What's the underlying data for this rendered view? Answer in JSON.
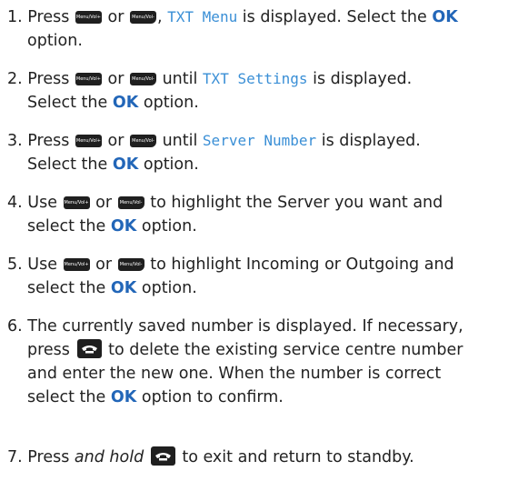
{
  "keys": {
    "up": "Menu/Vol+",
    "down": "Menu/Vol-"
  },
  "ok": "OK",
  "steps": {
    "s1": {
      "num": "1.",
      "a": "Press",
      "or": "or",
      "b": ",",
      "lcd": "TXT Menu",
      "c": "is displayed. Select the",
      "d": "option."
    },
    "s2": {
      "num": "2.",
      "a": "Press",
      "or": "or",
      "b": "until",
      "lcd": "TXT Settings",
      "c": "is displayed.",
      "d": "Select the",
      "e": "option."
    },
    "s3": {
      "num": "3.",
      "a": "Press",
      "or": "or",
      "b": "until",
      "lcd": "Server Number",
      "c": "is displayed.",
      "d": "Select the",
      "e": "option."
    },
    "s4": {
      "num": "4.",
      "a": "Use",
      "or": "or",
      "b": "to highlight the Server you want and",
      "c": "select the",
      "d": "option."
    },
    "s5": {
      "num": "5.",
      "a": "Use",
      "or": "or",
      "b": "to highlight Incoming or Outgoing and",
      "c": "select the",
      "d": "option."
    },
    "s6": {
      "num": "6.",
      "l1": "The currently saved number is displayed. If necessary,",
      "l2a": "press",
      "l2b": "to delete the existing service centre number",
      "l3": "and enter the new one. When the number is correct",
      "l4a": "select the",
      "l4b": "option to confirm."
    },
    "s7": {
      "num": "7.",
      "a": "Press",
      "em": "and hold",
      "b": "to exit and return to standby."
    }
  }
}
